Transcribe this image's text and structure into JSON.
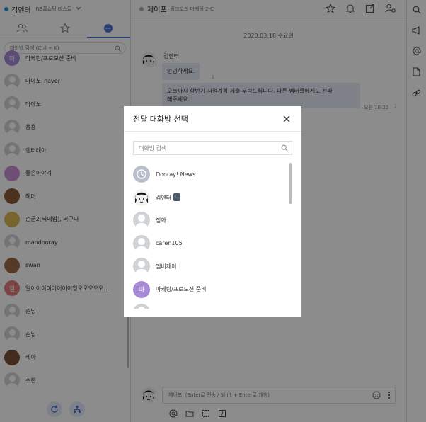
{
  "sidebar": {
    "user_name": "김엔터",
    "org_name": "NS홈쇼핑 테스트",
    "search_placeholder": "대화방 검색 (Ctrl + K)",
    "rooms": [
      {
        "name": "마케팅/프로모션 준비",
        "avatar_text": "마",
        "avatar_color": "#a78bd6"
      },
      {
        "name": "마에노_naver"
      },
      {
        "name": "마에노"
      },
      {
        "name": "용용"
      },
      {
        "name": "엔터레아"
      },
      {
        "name": "좋은이야기",
        "avatar_color": "#c98fd6"
      },
      {
        "name": "혜더",
        "avatar_color": "#8a5a3a"
      },
      {
        "name": "손군2[닉네임], 바구니",
        "avatar_color": "#d9b94f"
      },
      {
        "name": "mandooray"
      },
      {
        "name": "swan",
        "avatar_color": "#9b6a4a"
      },
      {
        "name": "일이이이이이이이이잉오오오오오...",
        "avatar_text": "일",
        "avatar_color": "#e07a7a"
      },
      {
        "name": "손님"
      },
      {
        "name": "손님"
      },
      {
        "name": "레아",
        "avatar_color": "#7a5035"
      },
      {
        "name": "수한"
      }
    ]
  },
  "channel": {
    "title": "제이포",
    "subtitle": "링크코드 마케팅 2-C",
    "date": "2020.03.18 수요일",
    "author": "김엔터",
    "messages": [
      {
        "text": "안녕하세요.",
        "read": "1"
      },
      {
        "text_line1": "오늘까지 상반기 사업계획 제출 부탁드립니다. 다른 멤버들에게도 전파",
        "text_line2": "해주세요.",
        "time": "오전 10:22",
        "read": "1"
      }
    ],
    "composer_placeholder": "제이포  (Enter로 전송 / Shift + Enter로 개행)"
  },
  "modal": {
    "title": "전달 대화방 선택",
    "search_placeholder": "대화방 검색",
    "items": [
      {
        "name": "Dooray! News",
        "avatar": "clock"
      },
      {
        "name": "김엔터",
        "badge": "나",
        "avatar": "face"
      },
      {
        "name": "정화",
        "avatar": "generic"
      },
      {
        "name": "caren105",
        "avatar": "generic"
      },
      {
        "name": "멤버제이",
        "avatar": "generic"
      },
      {
        "name": "마케팅/프로모션 준비",
        "avatar": "text",
        "avatar_text": "마",
        "avatar_color": "#a78bd6"
      }
    ]
  },
  "colors": {
    "accent": "#4a6fd6",
    "bubble": "#e8ecf7",
    "overlay": "rgba(0,0,0,0.45)"
  }
}
